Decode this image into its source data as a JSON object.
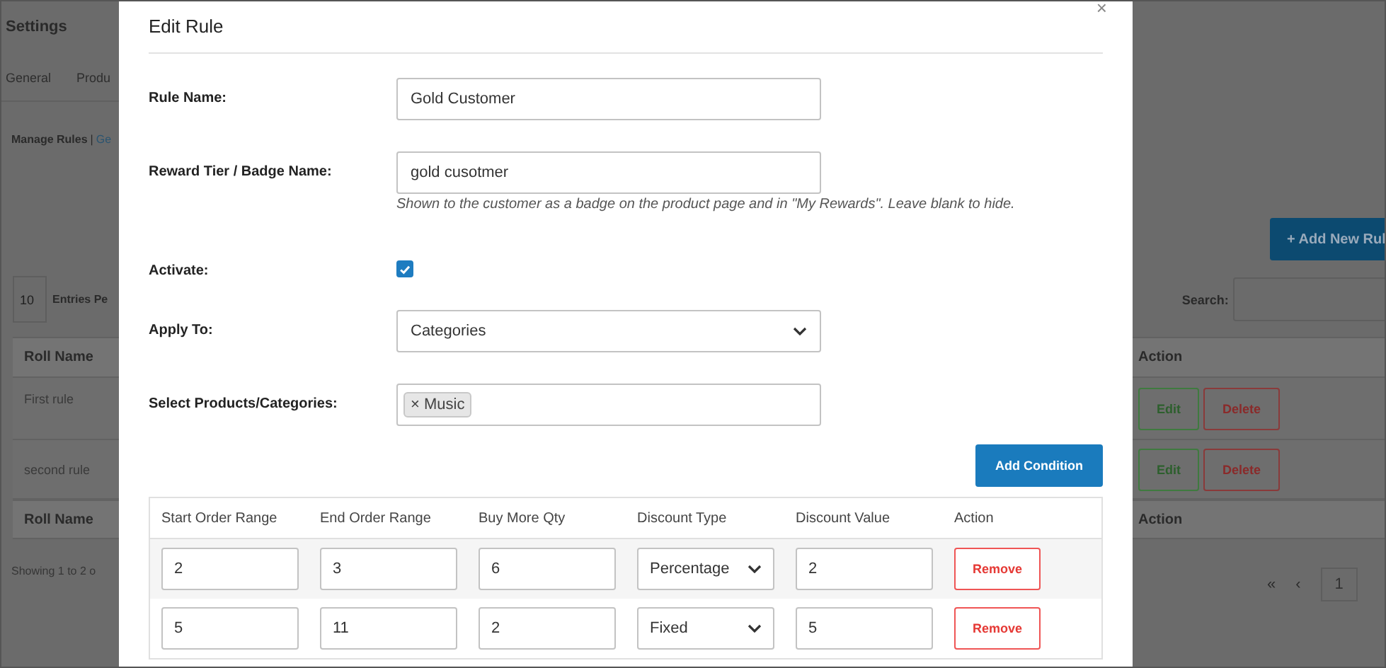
{
  "background": {
    "title": "Settings",
    "tabs": [
      "General",
      "Produ"
    ],
    "breadcrumb": {
      "current": "Manage Rules",
      "separator": "|",
      "link": "Ge"
    },
    "entries": {
      "value": "10",
      "label": "Entries Pe"
    },
    "add_button": "+ Add New Rul",
    "search": {
      "label": "Search:"
    },
    "table": {
      "columns": [
        "Roll Name",
        "Action"
      ],
      "rows": [
        {
          "name": "First rule",
          "actions": [
            {
              "label": "Edit",
              "kind": "edit"
            },
            {
              "label": "Delete",
              "kind": "delete"
            }
          ]
        },
        {
          "name": "second rule",
          "actions": [
            {
              "label": "Edit",
              "kind": "edit"
            },
            {
              "label": "Delete",
              "kind": "delete"
            }
          ]
        }
      ],
      "footer": [
        "Roll Name",
        "Action"
      ]
    },
    "showing": "Showing 1 to 2 o",
    "pagination": [
      {
        "label": "«",
        "selected": false
      },
      {
        "label": "‹",
        "selected": false
      },
      {
        "label": "1",
        "selected": true
      }
    ]
  },
  "modal": {
    "title": "Edit Rule",
    "close": "×",
    "fields": [
      {
        "kind": "text",
        "label": "Rule Name:",
        "value": "Gold Customer"
      },
      {
        "kind": "text",
        "label": "Reward Tier / Badge Name:",
        "value": "gold cusotmer",
        "help": "Shown to the customer as a badge on the product page and in \"My Rewards\". Leave blank to hide."
      },
      {
        "kind": "checkbox",
        "label": "Activate:",
        "checked": true
      },
      {
        "kind": "select",
        "label": "Apply To:",
        "value": "Categories"
      },
      {
        "kind": "tags",
        "label": "Select Products/Categories:",
        "tags": [
          {
            "remove": "×",
            "label": "Music"
          }
        ]
      }
    ],
    "add_condition": "Add Condition",
    "conditions": {
      "columns": [
        "Start Order Range",
        "End Order Range",
        "Buy More Qty",
        "Discount Type",
        "Discount Value",
        "Action"
      ],
      "rows": [
        {
          "start": "2",
          "end": "3",
          "qty": "6",
          "type": "Percentage",
          "value": "2",
          "action": "Remove"
        },
        {
          "start": "5",
          "end": "11",
          "qty": "2",
          "type": "Fixed",
          "value": "5",
          "action": "Remove"
        }
      ]
    }
  }
}
